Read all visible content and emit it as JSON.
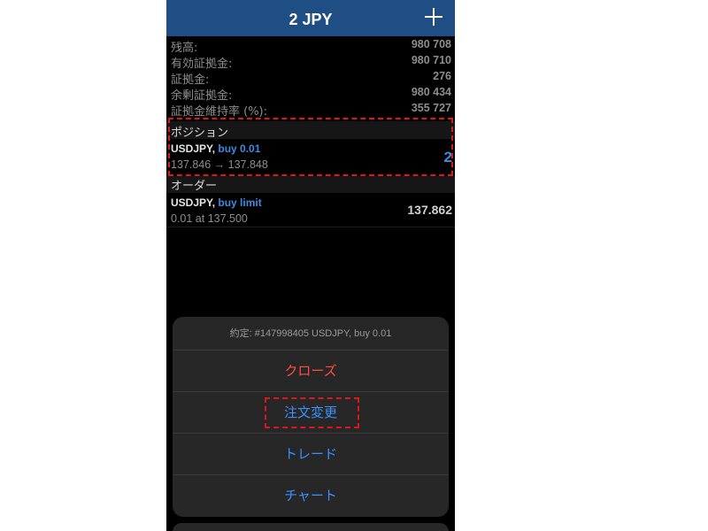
{
  "header": {
    "title": "2 JPY",
    "add_icon": "plus-icon"
  },
  "summary": [
    {
      "label": "残高:",
      "value": "980 708"
    },
    {
      "label": "有効証拠金:",
      "value": "980 710"
    },
    {
      "label": "証拠金:",
      "value": "276"
    },
    {
      "label": "余剰証拠金:",
      "value": "980 434"
    },
    {
      "label": "証拠金維持率 (%):",
      "value": "355 727"
    }
  ],
  "positions": {
    "section_label": "ポジション",
    "items": [
      {
        "symbol": "USDJPY,",
        "side": "buy 0.01",
        "prices": "137.846 → 137.848",
        "profit": "2"
      }
    ]
  },
  "orders": {
    "section_label": "オーダー",
    "items": [
      {
        "symbol": "USDJPY,",
        "side": "buy limit",
        "detail": "0.01 at 137.500",
        "price": "137.862"
      }
    ]
  },
  "action_sheet": {
    "title": "約定: #147998405 USDJPY, buy 0.01",
    "buttons": [
      {
        "label": "クローズ",
        "color": "#ff4d3d"
      },
      {
        "label": "注文変更",
        "color": "#3b92ff"
      },
      {
        "label": "トレード",
        "color": "#3b92ff"
      },
      {
        "label": "チャート",
        "color": "#3b92ff"
      }
    ]
  },
  "colors": {
    "header_bg": "#1f4e85",
    "accent_blue": "#3d8be0",
    "highlight_red": "#e0161b"
  }
}
